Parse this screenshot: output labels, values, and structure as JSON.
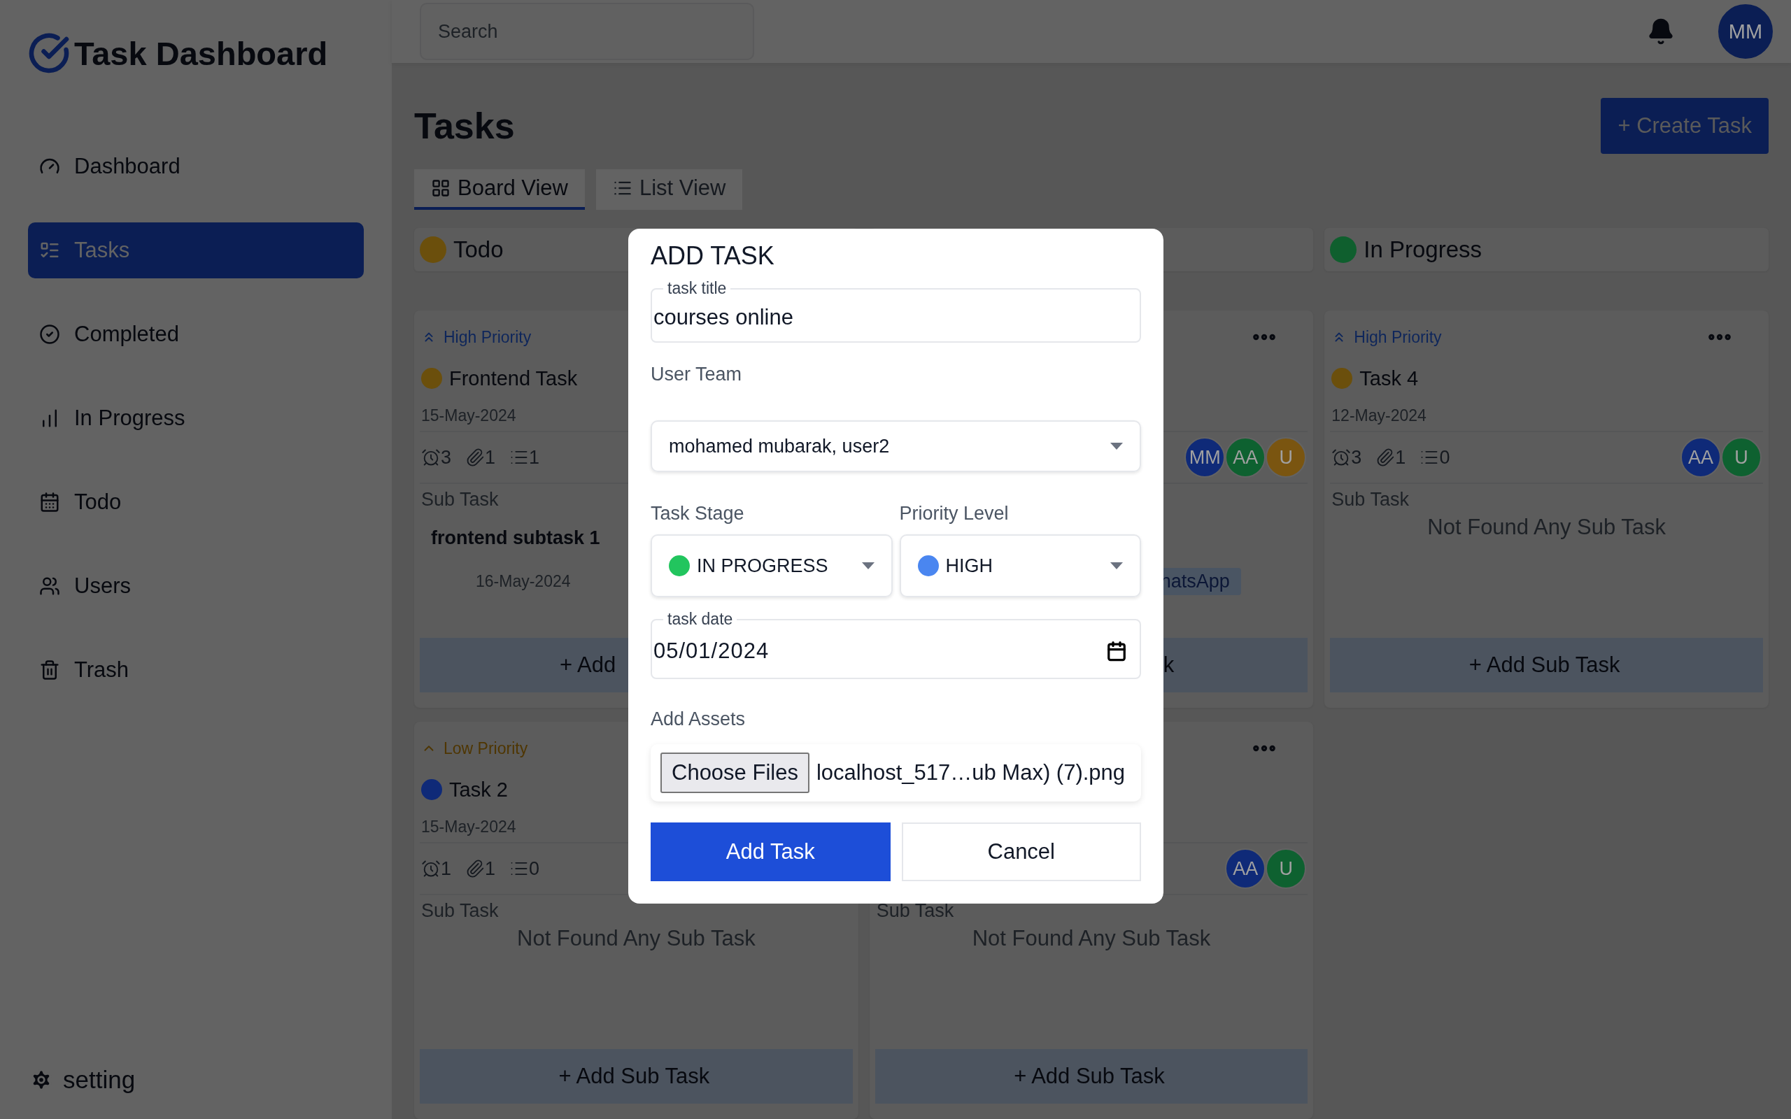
{
  "app": {
    "title": "Task Dashboard"
  },
  "sidebar": {
    "items": [
      {
        "label": "Dashboard",
        "selected": false
      },
      {
        "label": "Tasks",
        "selected": true
      },
      {
        "label": "Completed",
        "selected": false
      },
      {
        "label": "In Progress",
        "selected": false
      },
      {
        "label": "Todo",
        "selected": false
      },
      {
        "label": "Users",
        "selected": false
      },
      {
        "label": "Trash",
        "selected": false
      }
    ],
    "footer": "setting"
  },
  "header": {
    "search": {
      "placeholder": "Search"
    },
    "avatar": "MM"
  },
  "page": {
    "title": "Tasks",
    "create_button": "+ Create Task",
    "tabs": [
      {
        "label": "Board View",
        "selected": true
      },
      {
        "label": "List View",
        "selected": false
      }
    ]
  },
  "columns": [
    {
      "label": "Todo",
      "color": "#6b4f0c",
      "cards": [
        {
          "priority": {
            "label": "High Priority",
            "kind": "high"
          },
          "title": "Frontend Task",
          "color": "#6b4f0c",
          "date": "15-May-2024",
          "counts": [
            "3",
            "1",
            "1"
          ],
          "subtask_label": "Sub Task",
          "subtasks": [
            {
              "title": "frontend subtask 1",
              "date": "16-May-2024"
            }
          ],
          "add_button": {
            "label": "+ Add"
          }
        },
        {
          "priority": {
            "label": "Low Priority",
            "kind": "low"
          },
          "title": "Task 2",
          "color": "#0f2a78",
          "date": "15-May-2024",
          "counts": [
            "1",
            "1",
            "0"
          ],
          "subtask_label": "Sub Task",
          "empty_text": "Not Found Any Sub Task",
          "add_button": {
            "label": "+ Add Sub Task"
          }
        }
      ]
    },
    {
      "cards": [
        {
          "menu": true,
          "avatars": [
            {
              "initials": "MM",
              "color": "#0f2a78"
            },
            {
              "initials": "AA",
              "color": "#0e6130"
            },
            {
              "initials": "U",
              "color": "#7a5510"
            }
          ],
          "subtasks": [
            {
              "tag": "hatsApp"
            }
          ],
          "add_button": {
            "label": "k"
          }
        },
        {
          "menu": true,
          "avatars": [
            {
              "initials": "AA",
              "color": "#0f2a78"
            },
            {
              "initials": "U",
              "color": "#0e6130"
            }
          ],
          "subtask_label": "Sub Task",
          "empty_text": "Not Found Any Sub Task",
          "add_button": {
            "label": "+ Add Sub Task"
          }
        }
      ]
    },
    {
      "label": "In Progress",
      "color": "#0f5f2e",
      "cards": [
        {
          "priority": {
            "label": "High Priority",
            "kind": "high"
          },
          "menu": true,
          "title": "Task 4",
          "color": "#6b4f0c",
          "date": "12-May-2024",
          "counts": [
            "3",
            "1",
            "0"
          ],
          "avatars": [
            {
              "initials": "AA",
              "color": "#0f2a78"
            },
            {
              "initials": "U",
              "color": "#0e6130"
            }
          ],
          "subtask_label": "Sub Task",
          "empty_text": "Not Found Any Sub Task",
          "add_button": {
            "label": "+ Add Sub Task"
          }
        }
      ]
    }
  ],
  "modal": {
    "title": "ADD TASK",
    "title_field": {
      "label": "task title",
      "value": "courses online"
    },
    "team": {
      "label": "User Team",
      "value": "mohamed mubarak, user2"
    },
    "stage": {
      "label": "Task Stage",
      "value": "IN PROGRESS",
      "color": "#22c55e"
    },
    "priority": {
      "label": "Priority Level",
      "value": "HIGH",
      "color": "#4a86f0"
    },
    "date_field": {
      "label": "task date",
      "value": "05/01/2024"
    },
    "assets": {
      "label": "Add Assets",
      "button": "Choose Files",
      "file": "localhost_517…ub Max) (7).png"
    },
    "buttons": {
      "submit": "Add Task",
      "cancel": "Cancel"
    }
  }
}
